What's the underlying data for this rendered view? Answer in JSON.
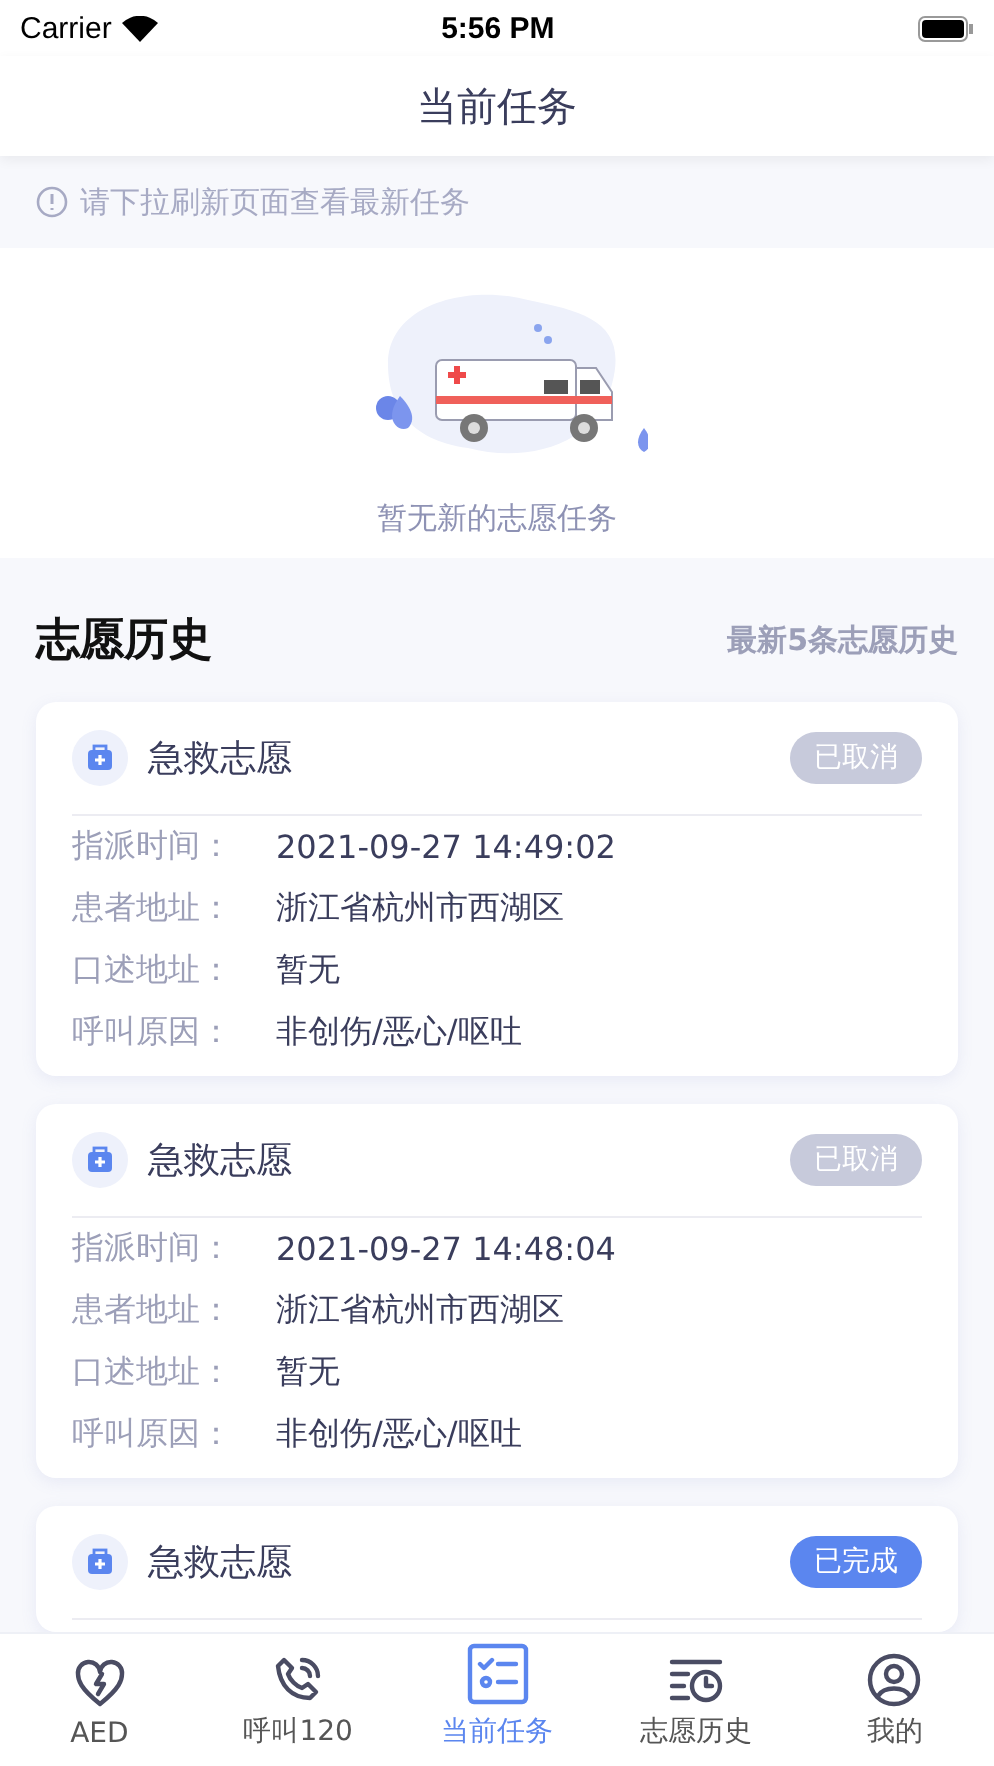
{
  "status_bar": {
    "carrier": "Carrier",
    "time": "5:56 PM"
  },
  "nav": {
    "title": "当前任务"
  },
  "tip": "请下拉刷新页面查看最新任务",
  "empty_state": {
    "kind": "picture",
    "message": "暂无新的志愿任务"
  },
  "history": {
    "title": "志愿历史",
    "subtitle": "最新5条志愿历史",
    "cards": [
      {
        "title": "急救志愿",
        "status": "已取消",
        "color": "#c7cadb",
        "fields": [
          {
            "label": "指派时间：",
            "value": "2021-09-27 14:49:02"
          },
          {
            "label": "患者地址：",
            "value": "浙江省杭州市西湖区"
          },
          {
            "label": "口述地址：",
            "value": "暂无"
          },
          {
            "label": "呼叫原因：",
            "value": "非创伤/恶心/呕吐"
          }
        ]
      },
      {
        "title": "急救志愿",
        "status": "已取消",
        "color": "#c7cadb",
        "fields": [
          {
            "label": "指派时间：",
            "value": "2021-09-27 14:48:04"
          },
          {
            "label": "患者地址：",
            "value": "浙江省杭州市西湖区"
          },
          {
            "label": "口述地址：",
            "value": "暂无"
          },
          {
            "label": "呼叫原因：",
            "value": "非创伤/恶心/呕吐"
          }
        ]
      },
      {
        "title": "急救志愿",
        "status": "已完成",
        "color": "#5b86ef"
      }
    ]
  },
  "tab_bar": [
    {
      "label": "AED",
      "selected": false
    },
    {
      "label": "呼叫120",
      "selected": false
    },
    {
      "label": "当前任务",
      "selected": true
    },
    {
      "label": "志愿历史",
      "selected": false
    },
    {
      "label": "我的",
      "selected": false
    }
  ]
}
